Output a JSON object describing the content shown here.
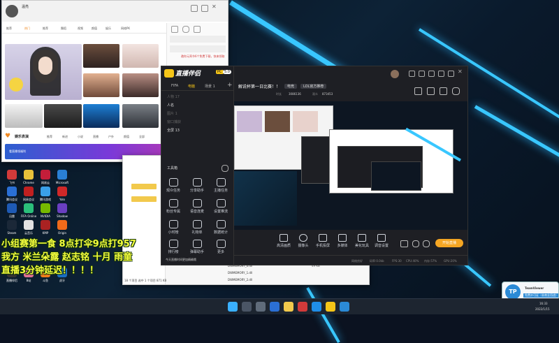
{
  "browser": {
    "user_name": "温亮",
    "tabs": [
      "推荐",
      "热门",
      "推荐",
      "舞蹈",
      "视频",
      "颜值",
      "娱乐",
      "网络PK"
    ],
    "notice_text": "邀你元宵节6个免费下载，快来领取",
    "section_title": "娱乐表演",
    "section_tabs": [
      "推荐",
      "新进",
      "小说",
      "直播",
      "户外",
      "颜值",
      "全部"
    ],
    "promo_text": "看直播领福利"
  },
  "zhibo_app": {
    "logo": "直播伴侣",
    "logo_badge": "PC",
    "version_badge": "5.0",
    "tabs": [
      "FIFA",
      "电脑",
      "场景 1"
    ],
    "scene_label": "场景 1",
    "sources": [
      "人物 17",
      "人名",
      "图片 1",
      "窗口捕获",
      "全屏 13"
    ],
    "tools_label": "工具箱",
    "tools": [
      "观众任务",
      "分享助手",
      "主播任务",
      "粉丝专属",
      "语音连麦",
      "设置推流",
      "小时榜",
      "礼物单",
      "数据统计",
      "排行榜",
      "弹幕助手",
      "更多"
    ],
    "status_text": "今天直播时间更加精确哦",
    "stream_title": "解说杯第一日比赛！！",
    "category": "电竞",
    "lol_tag": "LOL官方推荐",
    "stats": [
      {
        "label": "时长",
        "value": "3086136"
      },
      {
        "label": "观众",
        "value": "873453"
      }
    ],
    "controls": [
      "高清画质",
      "摄像头",
      "手机投屏",
      "多媒体",
      "美化玩具",
      "调音设置"
    ],
    "start_button": "开始直播",
    "footer": [
      "网络良好",
      "码率:0.0kb",
      "FPS:30",
      "CPU:40%",
      "内存:57%",
      "GPU:20%"
    ]
  },
  "overlay_lines": [
    "小组赛第一食 8点打伞9点打957",
    "我方 米兰朵露 赵志铭 十月 雨童",
    "直播3分钟延迟！！！！"
  ],
  "desktop_icons": [
    "飞书",
    "Chrome",
    "网易云",
    "Microsoft",
    "腾讯会议",
    "网易会议",
    "腾讯游戏",
    "Yolo",
    "迅雷",
    "FIFA Online",
    "NVIDIA",
    "Shadow",
    "Steam",
    "云音乐",
    "KMP",
    "Origin",
    "直播伴侣",
    "B站",
    "斗鱼",
    "虎牙",
    "WeGame",
    "OBS",
    "Discord",
    "QQ"
  ],
  "file_window": {
    "files": [
      "DWMEMORY_0.dll",
      "DWMEMORY_1.dll",
      "DWMEMORY_2.dll"
    ],
    "date": "2021/11/12 15:33",
    "size": "49 KB",
    "status": "18 个项目  选中 1 个项目  871 KB"
  },
  "teamviewer": {
    "title": "TeamViewer",
    "subtitle": "免费许可证（非商业用途）",
    "badge": "TP"
  },
  "taskbar": {
    "time": "16:33",
    "date": "2022/1/15"
  },
  "colors": {
    "accent_stripe": "#39c7ff",
    "overlay_text": "#f5ff3c",
    "start_button": "#f5a623"
  }
}
